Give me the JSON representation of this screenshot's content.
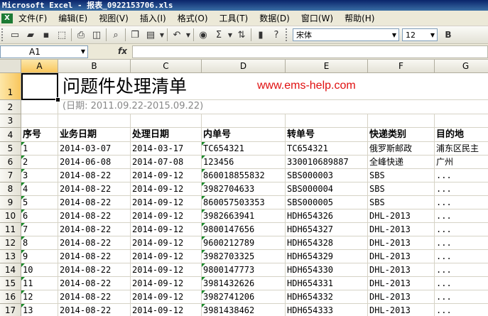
{
  "window": {
    "title": "Microsoft Excel - 报表_0922153706.xls"
  },
  "menu": [
    "文件(F)",
    "编辑(E)",
    "视图(V)",
    "插入(I)",
    "格式(O)",
    "工具(T)",
    "数据(D)",
    "窗口(W)",
    "帮助(H)"
  ],
  "toolbar": {
    "font_name": "宋体",
    "font_size": "12",
    "bold_label": "B"
  },
  "formula_bar": {
    "name_box": "A1",
    "fx_label": "fx",
    "content": ""
  },
  "columns": [
    "A",
    "B",
    "C",
    "D",
    "E",
    "F",
    "G"
  ],
  "sheet": {
    "title": "问题件处理清单",
    "url": "www.ems-help.com",
    "date_range": "(日期: 2011.09.22-2015.09.22)",
    "headers": [
      "序号",
      "业务日期",
      "处理日期",
      "内单号",
      "转单号",
      "快递类别",
      "目的地"
    ],
    "rows": [
      [
        "1",
        "2014-03-07",
        "2014-03-17",
        "TC654321",
        "TC654321",
        "俄罗斯邮政",
        "浦东区民主"
      ],
      [
        "2",
        "2014-06-08",
        "2014-07-08",
        "123456",
        "330010689887",
        "全峰快递",
        "广州"
      ],
      [
        "3",
        "2014-08-22",
        "2014-09-12",
        "860018855832",
        "SBS000003",
        "SBS",
        "..."
      ],
      [
        "4",
        "2014-08-22",
        "2014-09-12",
        "3982704633",
        "SBS000004",
        "SBS",
        "..."
      ],
      [
        "5",
        "2014-08-22",
        "2014-09-12",
        "860057503353",
        "SBS000005",
        "SBS",
        "..."
      ],
      [
        "6",
        "2014-08-22",
        "2014-09-12",
        "3982663941",
        "HDH654326",
        "DHL-2013",
        "..."
      ],
      [
        "7",
        "2014-08-22",
        "2014-09-12",
        "9800147656",
        "HDH654327",
        "DHL-2013",
        "..."
      ],
      [
        "8",
        "2014-08-22",
        "2014-09-12",
        "9600212789",
        "HDH654328",
        "DHL-2013",
        "..."
      ],
      [
        "9",
        "2014-08-22",
        "2014-09-12",
        "3982703325",
        "HDH654329",
        "DHL-2013",
        "..."
      ],
      [
        "10",
        "2014-08-22",
        "2014-09-12",
        "9800147773",
        "HDH654330",
        "DHL-2013",
        "..."
      ],
      [
        "11",
        "2014-08-22",
        "2014-09-12",
        "3981432626",
        "HDH654331",
        "DHL-2013",
        "..."
      ],
      [
        "12",
        "2014-08-22",
        "2014-09-12",
        "3982741206",
        "HDH654332",
        "DHL-2013",
        "..."
      ],
      [
        "13",
        "2014-08-22",
        "2014-09-12",
        "3981438462",
        "HDH654333",
        "DHL-2013",
        "..."
      ]
    ],
    "row_numbers": [
      "1",
      "2",
      "3",
      "4",
      "5",
      "6",
      "7",
      "8",
      "9",
      "10",
      "11",
      "12",
      "13",
      "14",
      "15",
      "16",
      "17"
    ]
  },
  "icons": [
    "app-icon",
    "new-icon",
    "open-icon",
    "save-icon",
    "permission-icon",
    "print-icon",
    "print-preview-icon",
    "research-icon",
    "copy-icon",
    "paste-icon",
    "undo-icon",
    "hyperlink-icon",
    "autosum-icon",
    "sort-icon",
    "chart-icon",
    "help-icon"
  ],
  "colors": {
    "title_bar": "#0a246a",
    "url_red": "#e01010",
    "date_gray": "#888888",
    "error_triangle": "#1a8a2a"
  }
}
